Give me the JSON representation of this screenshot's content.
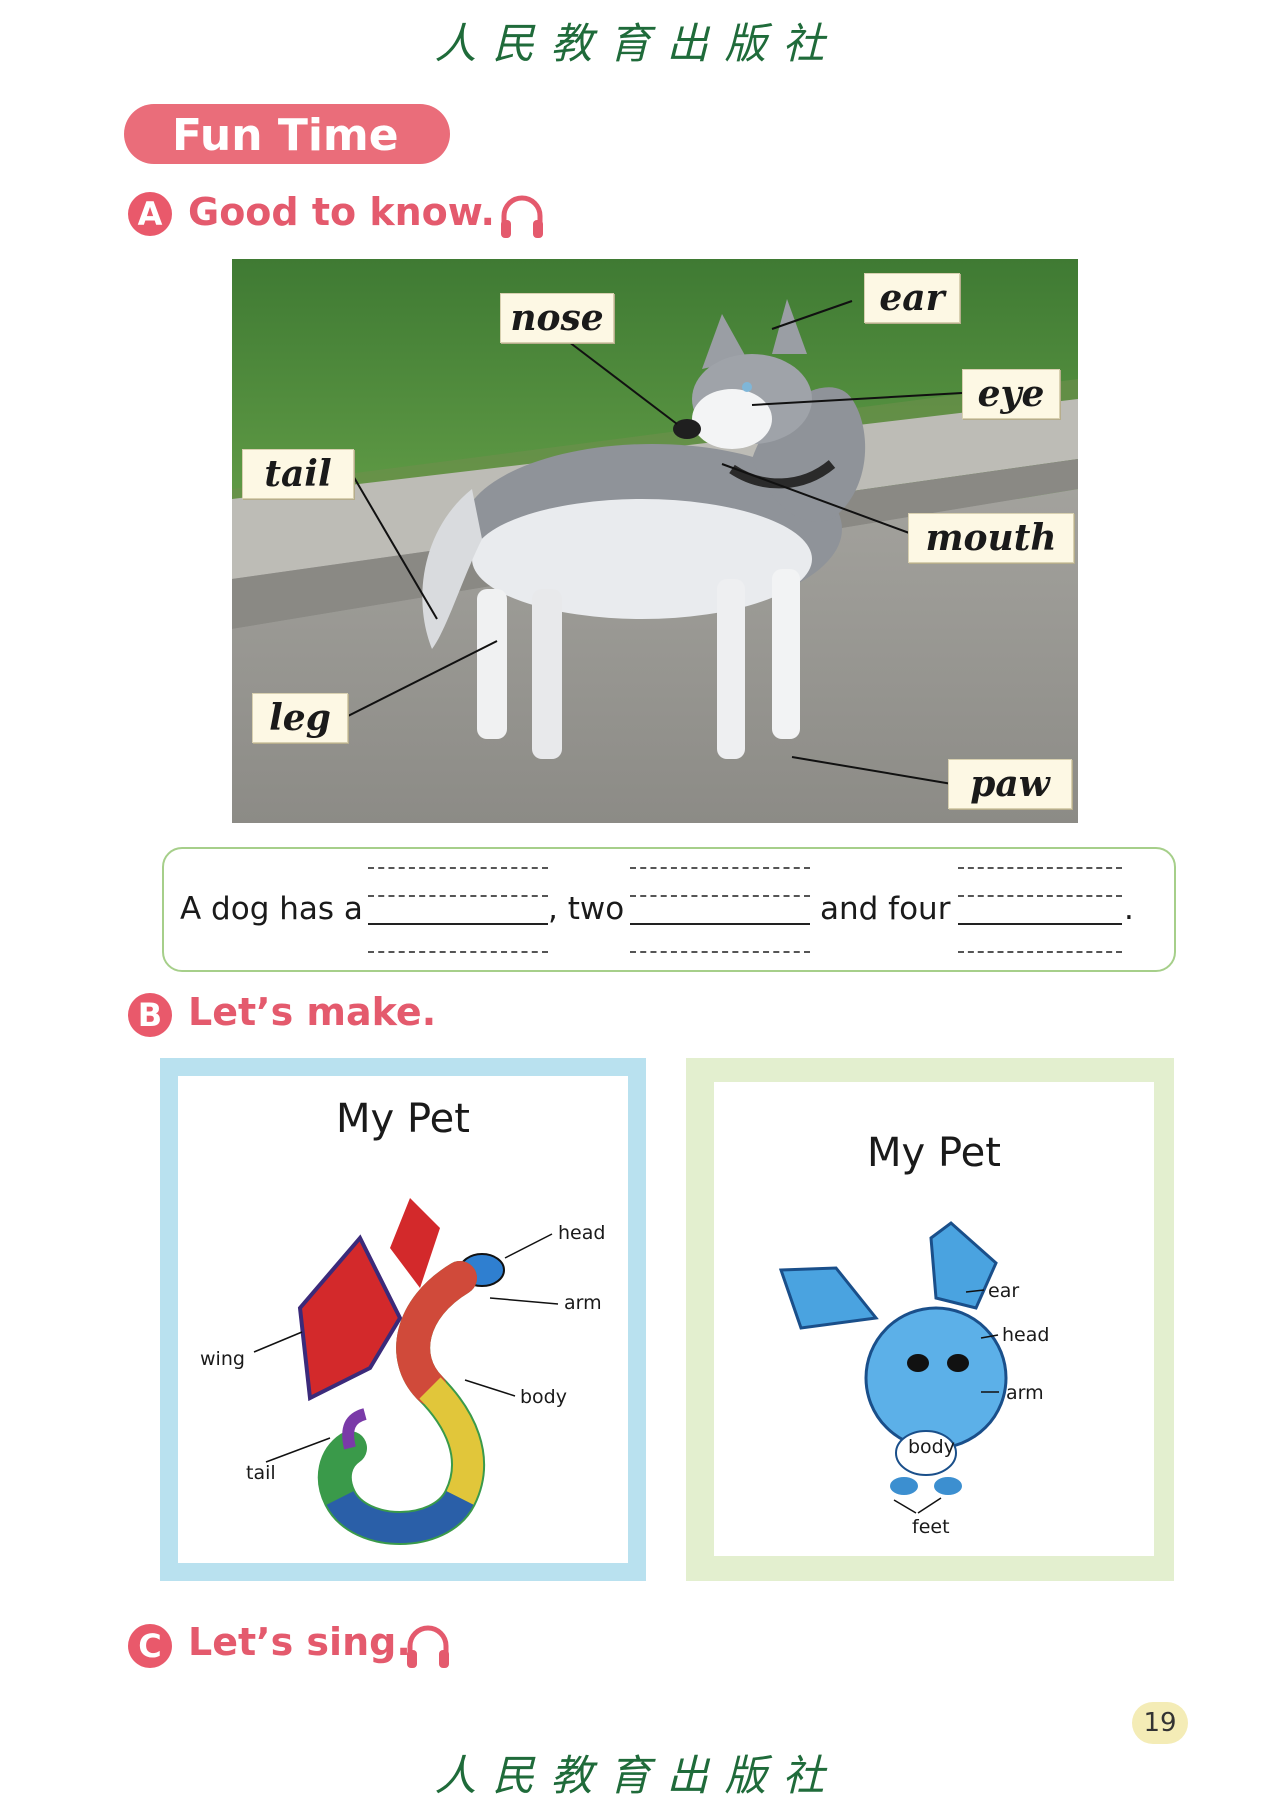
{
  "publisher": "人民教育出版社",
  "banner": {
    "title": "Fun Time"
  },
  "section_a": {
    "letter": "A",
    "title": "Good to know."
  },
  "photo_labels": {
    "nose": "nose",
    "ear": "ear",
    "eye": "eye",
    "tail": "tail",
    "mouth": "mouth",
    "leg": "leg",
    "paw": "paw"
  },
  "sentence": {
    "part1": "A dog has a",
    "part2": ", two",
    "part3": "and four",
    "end": "."
  },
  "section_b": {
    "letter": "B",
    "title": "Let’s make."
  },
  "card1": {
    "title": "My Pet",
    "labels": {
      "head": "head",
      "arm": "arm",
      "wing": "wing",
      "body": "body",
      "tail": "tail"
    }
  },
  "card2": {
    "title": "My Pet",
    "labels": {
      "ear": "ear",
      "head": "head",
      "arm": "arm",
      "body": "body",
      "feet": "feet"
    }
  },
  "section_c": {
    "letter": "C",
    "title": "Let’s sing."
  },
  "page_number": "19",
  "icons": {
    "audio": "headphones-icon"
  },
  "colors": {
    "accent": "#e45a6d",
    "banner": "#ea6d7a",
    "publisher": "#1f6b3a"
  }
}
